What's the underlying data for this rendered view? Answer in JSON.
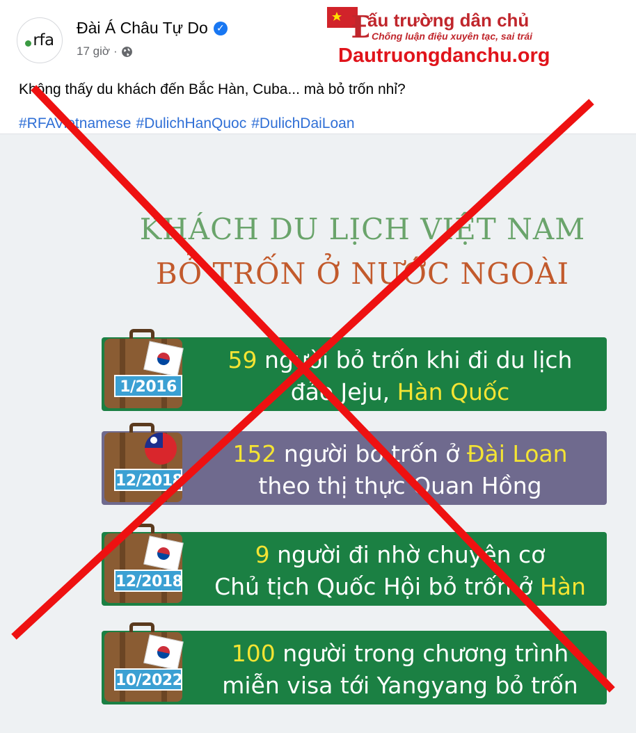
{
  "post": {
    "page_name": "Đài Á Châu Tự Do",
    "avatar_text": "rfa",
    "time": "17 giờ",
    "separator": "·",
    "text": "Không thấy du khách đến Bắc Hàn, Cuba... mà bỏ trốn nhỉ?",
    "hashtags": [
      "#RFAVietnamese",
      "#DulichHanQuoc",
      "#DulichDaiLoan"
    ]
  },
  "watermark": {
    "title": "ấu trường dân chủ",
    "logo_letter": "Đ",
    "slogan": "Chống luận điệu xuyên tạc, sai trái",
    "url": "Dautruongdanchu.org",
    "color": "#e0141b"
  },
  "infographic": {
    "title_line1": "KHÁCH DU LỊCH VIỆT NAM",
    "title_line2": "BỎ TRỐN Ở NƯỚC NGOÀI",
    "rows": [
      {
        "date": "1/2016",
        "flag": "korea-flag-icon",
        "color": "#1b8043",
        "line1_hl": "59",
        "line1": " người bỏ trốn khi đi du lịch",
        "line2": "đảo Jeju, ",
        "line2_hl": "Hàn Quốc"
      },
      {
        "date": "12/2018",
        "flag": "taiwan-flag-icon",
        "color": "#6f6a8e",
        "line1_hl": "152",
        "line1_mid": " người bỏ trốn ở ",
        "line1_hl2": "Đài Loan",
        "line2": "theo thị thực Quan Hồng"
      },
      {
        "date": "12/2018",
        "flag": "korea-flag-icon",
        "color": "#1b8043",
        "line1_hl": "9",
        "line1": " người đi nhờ chuyên cơ",
        "line2": "Chủ tịch Quốc Hội bỏ trốn ở ",
        "line2_hl": "Hàn"
      },
      {
        "date": "10/2022",
        "flag": "korea-flag-icon",
        "color": "#1b8043",
        "line1_hl": "100",
        "line1": " người trong chương trình",
        "line2": "miễn visa tới Yangyang bỏ trốn"
      }
    ]
  },
  "overlay": {
    "strike_color": "#ee1111"
  }
}
